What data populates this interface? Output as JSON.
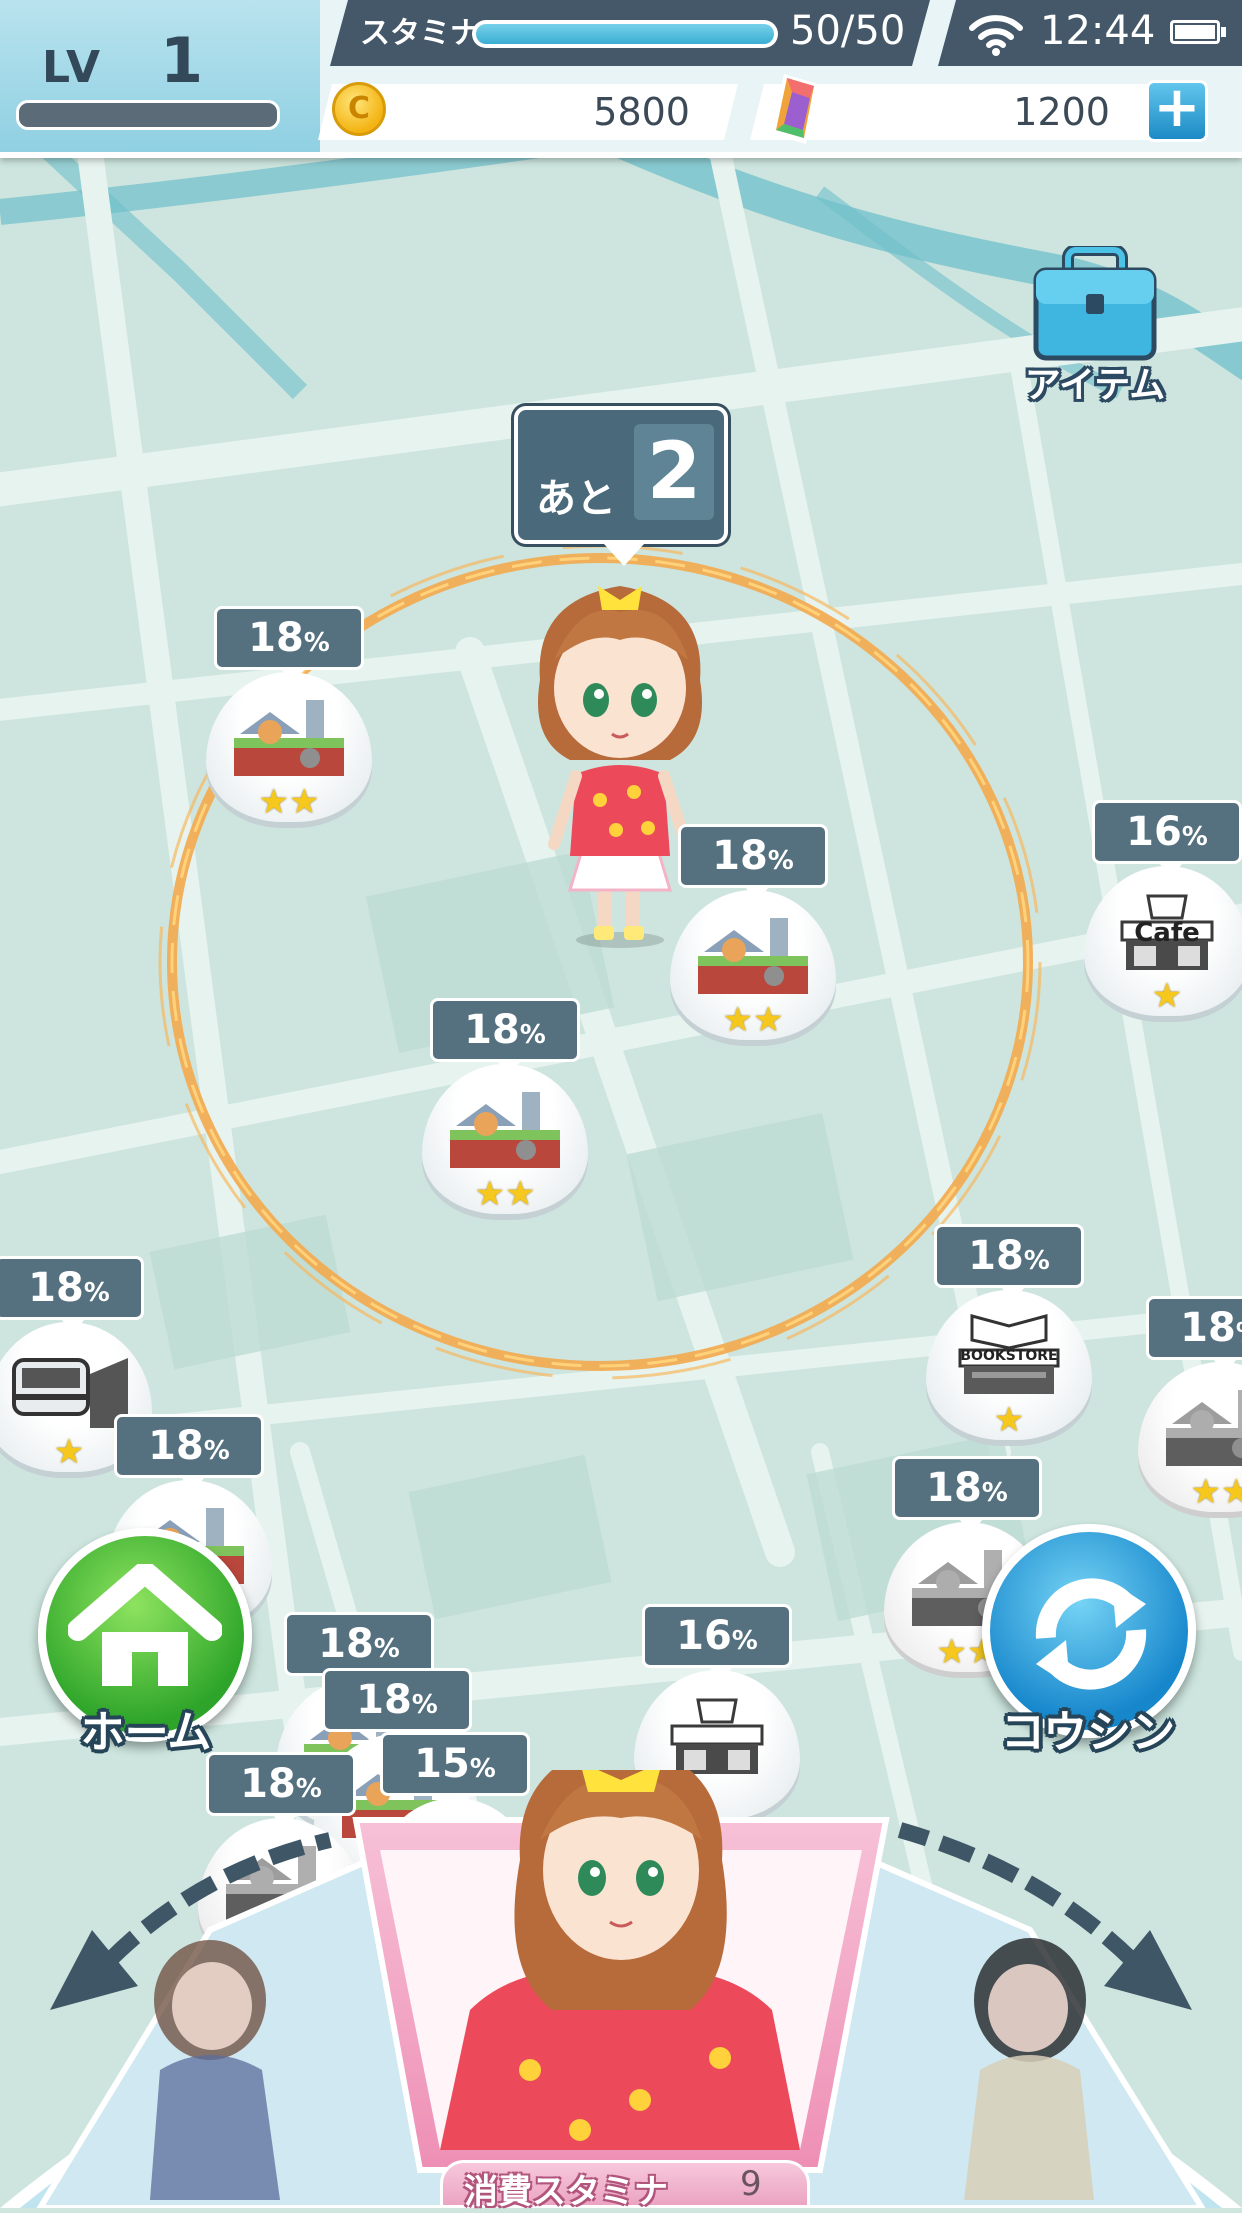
{
  "status": {
    "level_label": "LV",
    "level_value": "1",
    "level_progress": 0,
    "stamina_label": "スタミナ",
    "stamina_value": "50/50",
    "stamina_fraction": 1.0,
    "clock": "12:44",
    "coins": "5800",
    "gems": "1200",
    "plus_icon": "plus-icon"
  },
  "item_button": {
    "label": "アイテム",
    "icon": "toolbox-icon"
  },
  "remaining": {
    "label": "あと",
    "value": "2"
  },
  "spots": [
    {
      "percent": "18",
      "unit": "%",
      "type": "park",
      "stars": "★★",
      "gray": false
    },
    {
      "percent": "18",
      "unit": "%",
      "type": "park",
      "stars": "★★",
      "gray": false
    },
    {
      "percent": "16",
      "unit": "%",
      "type": "cafe",
      "stars": "★",
      "gray": false,
      "sign": "Cafe"
    },
    {
      "percent": "18",
      "unit": "%",
      "type": "park",
      "stars": "★★",
      "gray": false
    },
    {
      "percent": "18",
      "unit": "%",
      "type": "station",
      "stars": "★",
      "gray": false
    },
    {
      "percent": "18",
      "unit": "%",
      "type": "bookstore",
      "stars": "★",
      "gray": false,
      "sign": "BOOKSTORE"
    },
    {
      "percent": "18",
      "unit": "%",
      "type": "park",
      "stars": "★★",
      "gray": true
    },
    {
      "percent": "18",
      "unit": "%",
      "type": "park",
      "stars": "★★",
      "gray": true
    },
    {
      "percent": "18",
      "unit": "%",
      "type": "park",
      "stars": "",
      "gray": false
    },
    {
      "percent": "18",
      "unit": "%",
      "type": "park",
      "stars": "",
      "gray": false
    },
    {
      "percent": "18",
      "unit": "%",
      "type": "park",
      "stars": "",
      "gray": false
    },
    {
      "percent": "16",
      "unit": "%",
      "type": "cafe",
      "stars": "",
      "gray": false
    },
    {
      "percent": "15",
      "unit": "%",
      "type": "park",
      "stars": "",
      "gray": false
    },
    {
      "percent": "18",
      "unit": "%",
      "type": "park",
      "stars": "★",
      "gray": true
    }
  ],
  "home_button": {
    "label": "ホーム",
    "icon": "home-icon"
  },
  "update_button": {
    "label": "コウシン",
    "icon": "refresh-icon"
  },
  "stamina_cost": {
    "label": "消費スタミナ",
    "value": "9"
  },
  "colors": {
    "map_bg": "#cde5de",
    "road": "#e6f2ee",
    "river": "#5fb8c6",
    "range_ring": "#f0a24a",
    "tag": "#55707f"
  }
}
